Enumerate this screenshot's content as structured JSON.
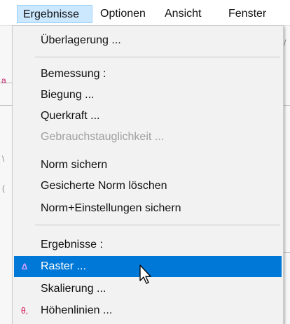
{
  "menubar": {
    "items": [
      {
        "label": "Ergebnisse",
        "active": true
      },
      {
        "label": "Optionen"
      },
      {
        "label": "Ansicht"
      },
      {
        "label": "Fenster"
      }
    ]
  },
  "menu": {
    "items": [
      {
        "label": "Überlagerung ..."
      },
      {
        "label": "Bemessung :"
      },
      {
        "label": "Biegung ..."
      },
      {
        "label": "Querkraft ..."
      },
      {
        "label": "Gebrauchstauglichkeit ...",
        "disabled": true
      },
      {
        "label": "Norm sichern"
      },
      {
        "label": "Gesicherte Norm löschen"
      },
      {
        "label": "Norm+Einstellungen sichern"
      },
      {
        "label": "Ergebnisse :"
      },
      {
        "label": "Raster ...",
        "selected": true,
        "icon": "raster-icon"
      },
      {
        "label": "Skalierung ..."
      },
      {
        "label": "Höhenlinien ...",
        "icon": "contour-lines-icon"
      }
    ]
  },
  "icons": {
    "raster_glyph": "Δ",
    "hoehen_glyph": "θ,"
  },
  "colors": {
    "selection": "#0078d7",
    "menubar_active": "#cce8ff",
    "disabled_text": "#a0a0a0",
    "icon_accent": "#c0206a"
  }
}
